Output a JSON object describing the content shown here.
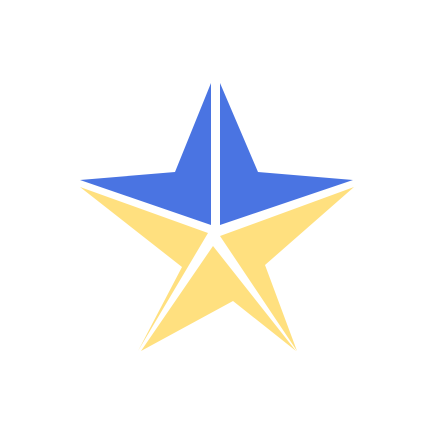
{
  "logo": {
    "icon": "star-icon",
    "colors": {
      "top_segments": "#4A74E2",
      "bottom_segments": "#FFE07F",
      "gap": "#FFFFFF",
      "background": "#FFFFFF"
    }
  }
}
